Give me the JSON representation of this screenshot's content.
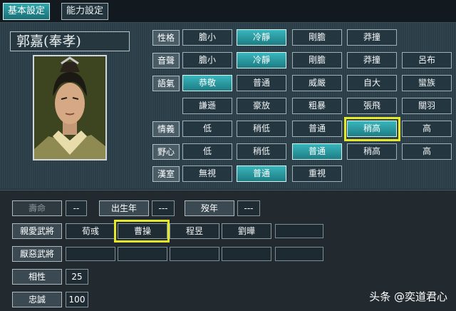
{
  "tabs": [
    "基本設定",
    "能力設定"
  ],
  "officer": {
    "name": "郭嘉(奉孝)"
  },
  "traits": {
    "personality": {
      "label": "性格",
      "options": [
        "膽小",
        "冷靜",
        "剛膽",
        "莽撞"
      ],
      "selected": 1
    },
    "voice": {
      "label": "音聲",
      "options": [
        "膽小",
        "冷靜",
        "剛膽",
        "莽撞",
        "呂布"
      ],
      "selected": 1
    },
    "tone": {
      "label": "語氣",
      "options": [
        "恭敬",
        "普通",
        "威嚴",
        "自大",
        "蠻族"
      ],
      "options2": [
        "謙遜",
        "豪放",
        "粗暴",
        "張飛",
        "關羽"
      ],
      "selected": 0
    },
    "loyalty_feel": {
      "label": "情義",
      "options": [
        "低",
        "稍低",
        "普通",
        "稍高",
        "高"
      ],
      "selected": 3
    },
    "ambition": {
      "label": "野心",
      "options": [
        "低",
        "稍低",
        "普通",
        "稍高",
        "高"
      ],
      "selected": 2
    },
    "han": {
      "label": "漢室",
      "options": [
        "無視",
        "普通",
        "重視"
      ],
      "selected": 1
    }
  },
  "lower": {
    "lifespan_label": "壽命",
    "lifespan_value": "--",
    "birth_label": "出生年",
    "birth_value": "---",
    "death_label": "歿年",
    "death_value": "---",
    "favored_label": "親愛武將",
    "favored": [
      "荀彧",
      "曹操",
      "程昱",
      "劉曄"
    ],
    "disliked_label": "厭惡武將",
    "compat_label": "相性",
    "compat_value": "25",
    "loyalty_label": "忠誠",
    "loyalty_value": "100"
  },
  "watermark": "头条 @奕道君心"
}
